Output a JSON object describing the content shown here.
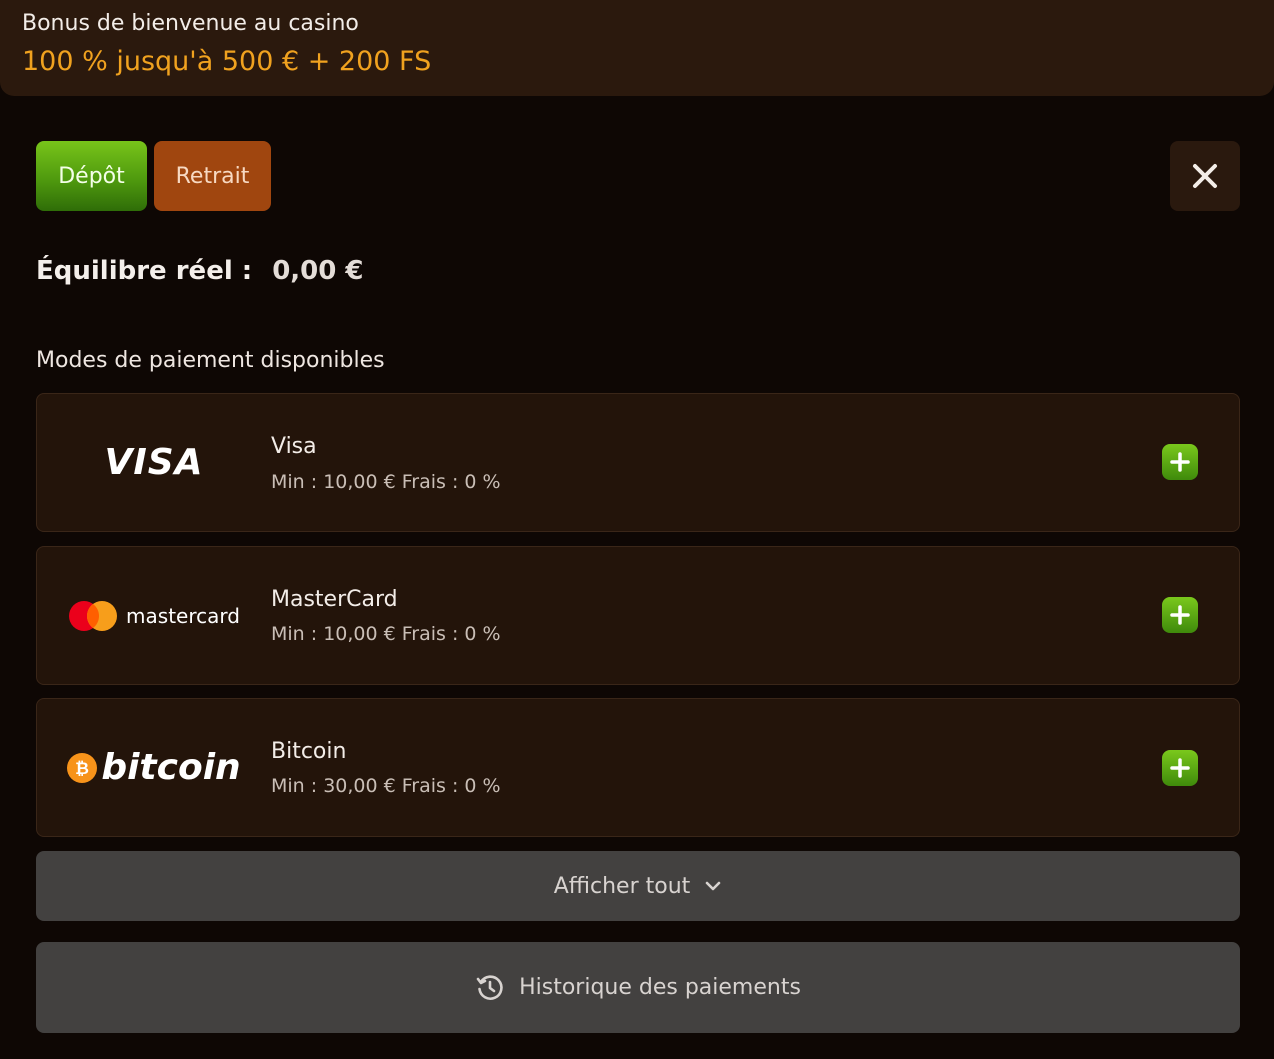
{
  "bonus": {
    "title": "Bonus de bienvenue au casino",
    "offer": "100 % jusqu'à 500 € + 200 FS"
  },
  "tabs": [
    {
      "label": "Dépôt",
      "active": true
    },
    {
      "label": "Retrait",
      "active": false
    }
  ],
  "close_icon": "close-icon",
  "balance": {
    "label": "Équilibre réel :",
    "amount": "0,00 €"
  },
  "section_title": "Modes de paiement disponibles",
  "methods": [
    {
      "logo": "VISA",
      "name": "Visa",
      "info": "Min : 10,00 € Frais : 0 %",
      "icon": "plus-icon"
    },
    {
      "logo": "mastercard",
      "name": "MasterCard",
      "info": "Min : 10,00 € Frais : 0 %",
      "icon": "plus-icon"
    },
    {
      "logo": "bitcoin",
      "name": "Bitcoin",
      "info": "Min : 30,00 € Frais : 0 %",
      "icon": "plus-icon"
    }
  ],
  "show_all": {
    "label": "Afficher tout",
    "icon": "chevron-down-icon"
  },
  "history": {
    "label": "Historique des paiements",
    "icon": "history-icon"
  },
  "colors": {
    "background": "#0e0704",
    "accent_orange": "#f0a21f",
    "deposit_green": "#5aa812",
    "withdraw_brown": "#a0460f",
    "card_bg": "#23140a"
  }
}
